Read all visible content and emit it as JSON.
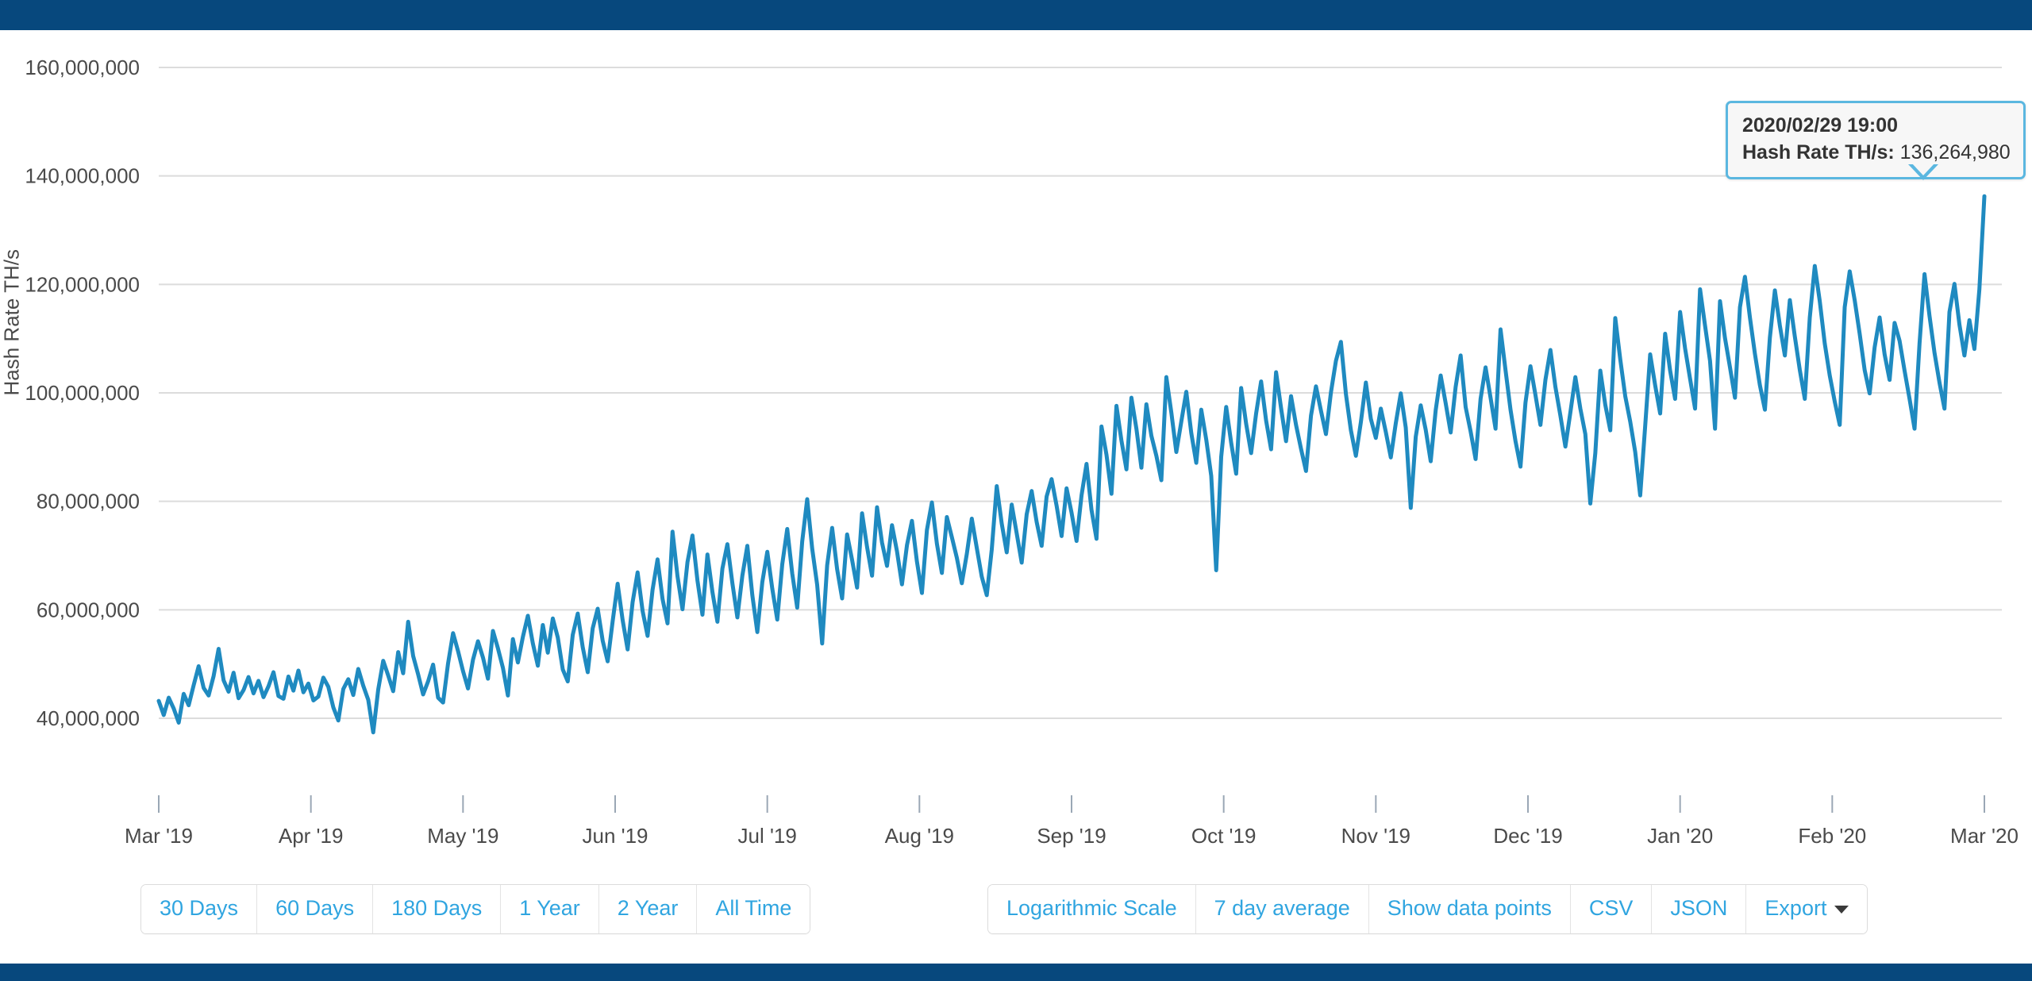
{
  "theme": {
    "bar_color": "#07487d",
    "line_color": "#1f8ac0",
    "link_color": "#30a5e0",
    "tooltip_border": "#5bb7e0",
    "tooltip_bg": "#f7f7f7",
    "grid_color": "#dcdcdc",
    "axis_text_color": "#4a4a4a"
  },
  "tooltip": {
    "date": "2020/02/29 19:00",
    "series_label": "Hash Rate TH/s",
    "separator": ": ",
    "value": "136,264,980"
  },
  "controls": {
    "range_buttons": [
      {
        "label": "30 Days"
      },
      {
        "label": "60 Days"
      },
      {
        "label": "180 Days"
      },
      {
        "label": "1 Year"
      },
      {
        "label": "2 Year"
      },
      {
        "label": "All Time"
      }
    ],
    "option_buttons": [
      {
        "label": "Logarithmic Scale"
      },
      {
        "label": "7 day average"
      },
      {
        "label": "Show data points"
      },
      {
        "label": "CSV"
      },
      {
        "label": "JSON"
      },
      {
        "label": "Export",
        "icon": "chevron-down-icon"
      }
    ]
  },
  "chart_data": {
    "type": "line",
    "title": "",
    "xlabel": "",
    "ylabel": "Hash Rate TH/s",
    "ylim": [
      34000000,
      166000000
    ],
    "ytick_values": [
      40000000,
      60000000,
      80000000,
      100000000,
      120000000,
      140000000,
      160000000
    ],
    "ytick_labels": [
      "40,000,000",
      "60,000,000",
      "80,000,000",
      "100,000,000",
      "120,000,000",
      "140,000,000",
      "160,000,000"
    ],
    "xtick_labels": [
      "Mar '19",
      "Apr '19",
      "May '19",
      "Jun '19",
      "Jul '19",
      "Aug '19",
      "Sep '19",
      "Oct '19",
      "Nov '19",
      "Dec '19",
      "Jan '20",
      "Feb '20",
      "Mar '20"
    ],
    "grid": "horizontal",
    "legend": "none",
    "series": [
      {
        "name": "Hash Rate TH/s",
        "color": "#1f8ac0",
        "values": [
          43200000,
          40600000,
          43800000,
          41800000,
          39200000,
          44500000,
          42400000,
          46100000,
          49600000,
          45600000,
          44200000,
          47800000,
          52800000,
          47000000,
          44900000,
          48400000,
          43700000,
          45200000,
          47600000,
          44600000,
          46900000,
          43900000,
          45900000,
          48500000,
          44100000,
          43600000,
          47700000,
          45100000,
          48800000,
          44800000,
          46400000,
          43300000,
          44000000,
          47500000,
          45800000,
          42000000,
          39600000,
          45400000,
          47200000,
          44300000,
          49100000,
          46000000,
          43400000,
          37400000,
          45300000,
          50600000,
          47900000,
          45000000,
          52200000,
          48300000,
          57800000,
          51500000,
          48100000,
          44400000,
          46800000,
          49900000,
          43800000,
          42900000,
          50100000,
          55700000,
          52400000,
          48700000,
          45500000,
          50800000,
          54200000,
          51200000,
          47300000,
          56100000,
          52900000,
          49300000,
          44200000,
          54600000,
          50300000,
          55000000,
          58900000,
          53800000,
          49700000,
          57200000,
          52100000,
          58400000,
          54900000,
          49000000,
          46800000,
          55400000,
          59300000,
          53100000,
          48500000,
          56600000,
          60200000,
          54300000,
          50500000,
          57900000,
          64800000,
          58100000,
          52700000,
          61400000,
          66900000,
          59800000,
          55200000,
          63700000,
          69300000,
          62000000,
          57500000,
          74400000,
          66200000,
          60100000,
          68800000,
          73700000,
          65400000,
          59100000,
          70200000,
          63300000,
          57800000,
          67600000,
          72100000,
          64900000,
          58600000,
          66300000,
          71800000,
          62700000,
          55900000,
          65100000,
          70700000,
          63900000,
          58200000,
          68400000,
          74900000,
          66700000,
          60400000,
          72600000,
          80400000,
          71300000,
          64600000,
          53800000,
          68200000,
          75100000,
          67500000,
          62100000,
          73900000,
          69200000,
          64100000,
          77800000,
          71600000,
          66300000,
          78900000,
          72400000,
          68100000,
          75600000,
          70800000,
          64700000,
          71900000,
          76400000,
          68900000,
          63100000,
          74700000,
          79800000,
          72200000,
          66800000,
          77100000,
          73400000,
          69600000,
          64900000,
          70300000,
          76800000,
          71400000,
          66100000,
          62700000,
          71100000,
          82800000,
          75900000,
          70600000,
          79400000,
          74100000,
          68700000,
          77600000,
          81900000,
          76200000,
          71800000,
          80900000,
          84100000,
          79200000,
          73600000,
          82400000,
          77900000,
          72700000,
          81100000,
          86900000,
          78400000,
          73100000,
          93800000,
          88600000,
          81400000,
          97600000,
          91200000,
          85900000,
          99100000,
          93400000,
          86200000,
          97900000,
          92100000,
          88400000,
          83900000,
          102900000,
          96400000,
          89100000,
          94700000,
          100200000,
          92600000,
          87100000,
          96900000,
          91400000,
          84700000,
          67300000,
          88200000,
          97400000,
          90800000,
          85100000,
          100900000,
          94300000,
          88900000,
          96200000,
          102100000,
          94900000,
          89600000,
          103800000,
          97200000,
          91100000,
          99400000,
          94100000,
          89700000,
          85600000,
          95800000,
          101200000,
          96700000,
          92400000,
          100100000,
          105900000,
          109400000,
          99800000,
          93100000,
          88400000,
          94600000,
          101900000,
          95200000,
          91700000,
          97100000,
          92800000,
          88100000,
          94400000,
          99900000,
          93600000,
          78800000,
          91900000,
          97700000,
          93200000,
          87400000,
          96800000,
          103200000,
          98100000,
          92700000,
          101100000,
          106900000,
          97400000,
          92900000,
          87800000,
          98900000,
          104700000,
          99100000,
          93400000,
          111700000,
          104200000,
          96900000,
          91100000,
          86400000,
          98200000,
          104900000,
          99600000,
          94100000,
          102400000,
          107900000,
          101100000,
          95800000,
          90100000,
          96400000,
          102900000,
          97100000,
          92400000,
          79600000,
          88900000,
          104100000,
          97800000,
          93100000,
          113800000,
          106200000,
          99400000,
          94700000,
          89100000,
          81100000,
          93900000,
          107100000,
          101400000,
          96200000,
          110900000,
          104100000,
          98900000,
          114900000,
          108200000,
          102600000,
          97100000,
          119100000,
          112400000,
          105900000,
          93400000,
          116900000,
          110100000,
          104700000,
          99100000,
          115800000,
          121400000,
          113900000,
          107200000,
          101400000,
          96900000,
          110200000,
          118900000,
          112400000,
          106900000,
          117100000,
          110400000,
          104200000,
          98900000,
          113900000,
          123400000,
          116900000,
          109100000,
          103200000,
          98400000,
          94100000,
          115800000,
          122400000,
          117100000,
          110900000,
          104200000,
          99900000,
          108400000,
          113900000,
          107100000,
          102400000,
          112900000,
          109600000,
          104100000,
          98900000,
          93400000,
          109100000,
          121900000,
          114200000,
          107400000,
          101900000,
          97100000,
          114900000,
          120100000,
          112600000,
          106900000,
          113400000,
          108100000,
          119100000,
          136264980
        ]
      }
    ]
  }
}
